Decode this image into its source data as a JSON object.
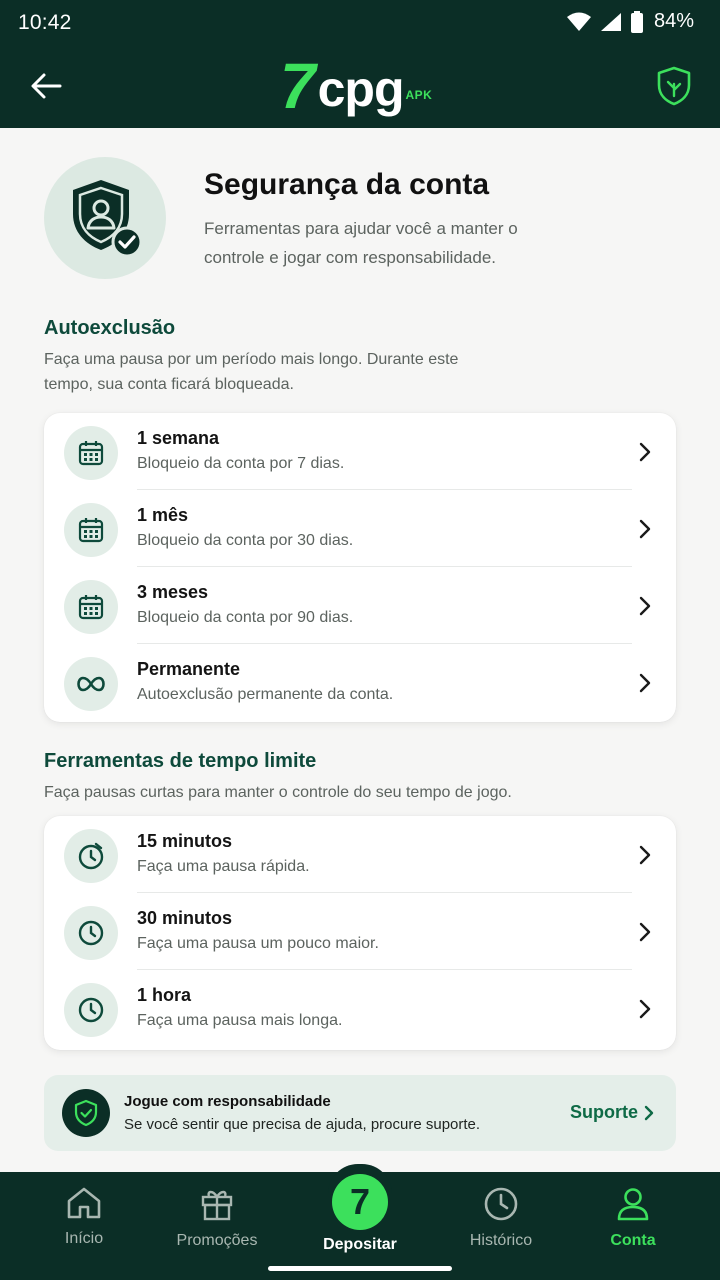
{
  "status_bar": {
    "time": "10:42",
    "battery": "84%"
  },
  "header": {
    "logo_main": "7",
    "logo_text": "cpg",
    "logo_tag": "APK"
  },
  "hero": {
    "title": "Segurança da conta",
    "description": "Ferramentas para ajudar você a manter o controle e jogar com responsabilidade."
  },
  "self_exclusion": {
    "title": "Autoexclusão",
    "description": "Faça uma pausa por um período mais longo. Durante este tempo, sua conta ficará bloqueada.",
    "items": [
      {
        "title": "1 semana",
        "desc": "Bloqueio da conta por 7 dias.",
        "icon": "calendar-icon"
      },
      {
        "title": "1 mês",
        "desc": "Bloqueio da conta por 30 dias.",
        "icon": "calendar-icon"
      },
      {
        "title": "3 meses",
        "desc": "Bloqueio da conta por 90 dias.",
        "icon": "calendar-icon"
      },
      {
        "title": "Permanente",
        "desc": "Autoexclusão permanente da conta.",
        "icon": "infinity-icon"
      }
    ]
  },
  "timeout": {
    "title": "Ferramentas de tempo limite",
    "description": "Faça pausas curtas para manter o controle do seu tempo de jogo.",
    "items": [
      {
        "title": "15 minutos",
        "desc": "Faça uma pausa rápida.",
        "icon": "clock-icon"
      },
      {
        "title": "30 minutos",
        "desc": "Faça uma pausa um pouco maior.",
        "icon": "clock-icon"
      },
      {
        "title": "1 hora",
        "desc": "Faça uma pausa mais longa.",
        "icon": "clock-icon"
      }
    ]
  },
  "support": {
    "title": "Jogue com responsabilidade",
    "description": "Se você sentir que precisa de ajuda, procure suporte.",
    "link": "Suporte"
  },
  "bottom_nav": {
    "items": [
      {
        "label": "Início",
        "icon": "home-icon"
      },
      {
        "label": "Promoções",
        "icon": "gift-icon"
      },
      {
        "label": "Depositar",
        "icon": "deposit-icon",
        "badge": "7"
      },
      {
        "label": "Histórico",
        "icon": "clock-icon"
      },
      {
        "label": "Conta",
        "icon": "user-icon",
        "active": true
      }
    ]
  },
  "colors": {
    "primary": "#0b2e26",
    "accent": "#3ce05c",
    "heading": "#0e4a3b",
    "soft": "#e2ede7"
  }
}
